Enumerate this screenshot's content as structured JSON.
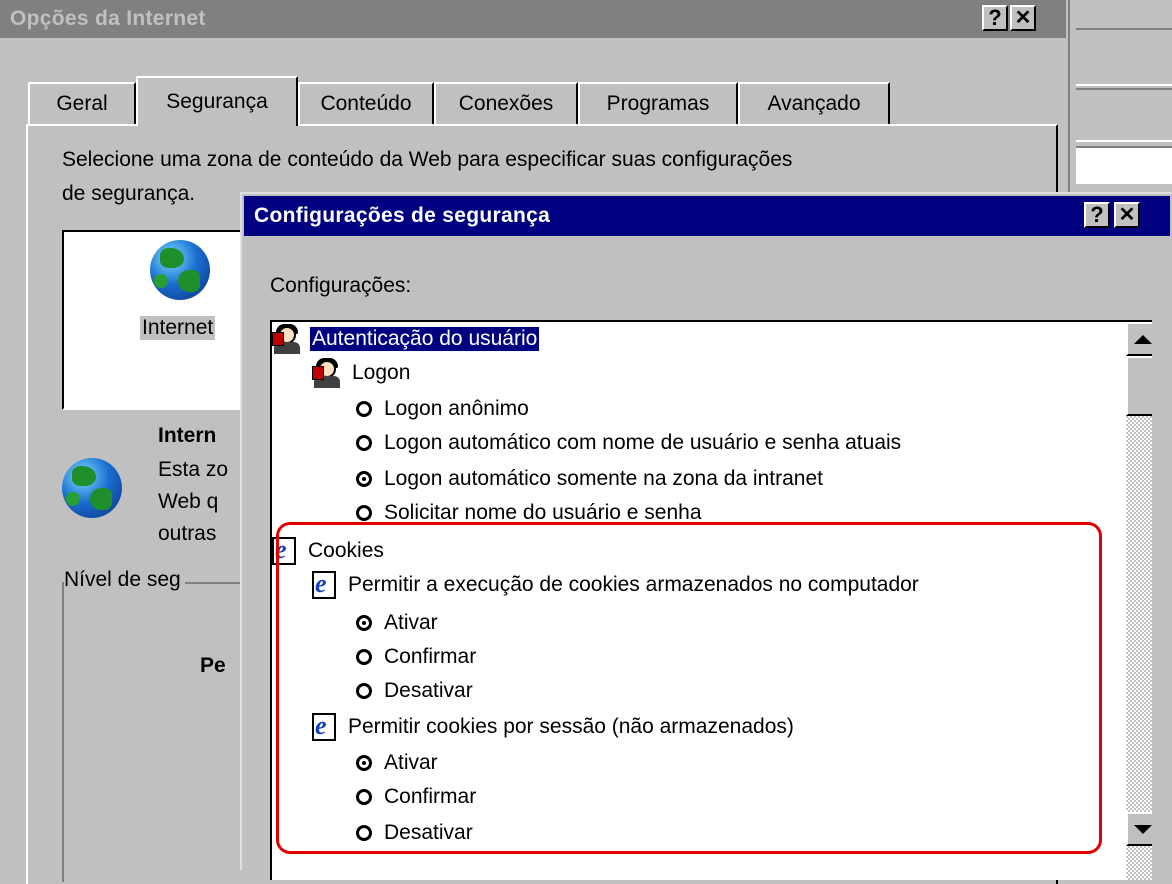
{
  "main_window": {
    "title": "Opções da Internet",
    "help_button": "?",
    "close_button": "✕",
    "tabs": [
      "Geral",
      "Segurança",
      "Conteúdo",
      "Conexões",
      "Programas",
      "Avançado"
    ],
    "instruction_line1": "Selecione uma zona de conteúdo da Web para especificar suas configurações",
    "instruction_line2": "de segurança.",
    "zone_label": "Internet",
    "zone_heading": "Intern",
    "zone_desc": [
      "Esta zo",
      "Web q",
      "outras"
    ],
    "security_level_group": "Nível de seg",
    "level_label": "Pe"
  },
  "security_dialog": {
    "title": "Configurações de segurança",
    "help_button": "?",
    "close_button": "✕",
    "settings_label": "Configurações:",
    "items": [
      {
        "type": "user",
        "label": "Autenticação do usuário"
      },
      {
        "type": "user",
        "label": "Logon"
      },
      {
        "type": "radio",
        "label": "Logon anônimo",
        "checked": false
      },
      {
        "type": "radio",
        "label": "Logon automático com nome de usuário e senha atuais",
        "checked": false
      },
      {
        "type": "radio",
        "label": "Logon automático somente na zona da intranet",
        "checked": true
      },
      {
        "type": "radio",
        "label": "Solicitar nome do usuário e senha",
        "checked": false
      },
      {
        "type": "ie",
        "label": "Cookies"
      },
      {
        "type": "ie",
        "label": "Permitir a execução de cookies armazenados no computador"
      },
      {
        "type": "radio",
        "label": "Ativar",
        "checked": true
      },
      {
        "type": "radio",
        "label": "Confirmar",
        "checked": false
      },
      {
        "type": "radio",
        "label": "Desativar",
        "checked": false
      },
      {
        "type": "ie",
        "label": "Permitir cookies por sessão (não armazenados)"
      },
      {
        "type": "radio",
        "label": "Ativar",
        "checked": true
      },
      {
        "type": "radio",
        "label": "Confirmar",
        "checked": false
      },
      {
        "type": "radio",
        "label": "Desativar",
        "checked": false
      }
    ]
  },
  "colors": {
    "annotation": "#e00000",
    "titlebar_active": "#000080",
    "titlebar_inactive": "#808080"
  }
}
